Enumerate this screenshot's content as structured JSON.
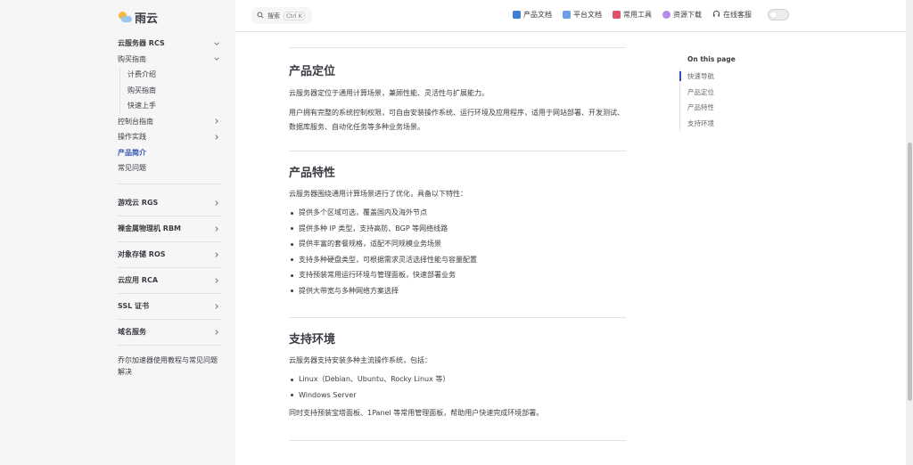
{
  "brand": {
    "name": "雨云"
  },
  "search": {
    "label": "搜索",
    "shortcut": "Ctrl K"
  },
  "topnav": [
    {
      "label": "产品文档",
      "icon": "book-icon",
      "color": "#3e7ed6"
    },
    {
      "label": "平台文档",
      "icon": "doc-icon",
      "color": "#6aa0e8"
    },
    {
      "label": "常用工具",
      "icon": "toolbox-icon",
      "color": "#e0506a"
    },
    {
      "label": "资源下载",
      "icon": "download-icon",
      "color": "#b88ce6"
    },
    {
      "label": "在线客服",
      "icon": "headset-icon",
      "color": "#555555"
    }
  ],
  "sidebar": {
    "group_title": "云服务器 RCS",
    "purchase_title": "购买指南",
    "purchase_items": [
      "计费介绍",
      "购买指南",
      "快速上手"
    ],
    "items": [
      {
        "label": "控制台指南",
        "expandable": true
      },
      {
        "label": "操作实践",
        "expandable": true
      },
      {
        "label": "产品简介",
        "active": true,
        "expandable": false
      },
      {
        "label": "常见问题",
        "expandable": false
      }
    ],
    "sections": [
      "游戏云 RGS",
      "裸金属物理机 RBM",
      "对象存储 ROS",
      "云应用 RCA",
      "SSL 证书",
      "域名服务"
    ],
    "footer": "乔尔加速器使用教程与常见问题解决"
  },
  "article": {
    "section1": {
      "title": "产品定位",
      "p1": "云服务器定位于通用计算场景，兼顾性能、灵活性与扩展能力。",
      "p2": "用户拥有完整的系统控制权限，可自由安装操作系统、运行环境及应用程序，适用于网站部署、开发测试、数据库服务、自动化任务等多种业务场景。"
    },
    "section2": {
      "title": "产品特性",
      "intro": "云服务器围绕通用计算场景进行了优化，具备以下特性：",
      "items": [
        "提供多个区域可选，覆盖国内及海外节点",
        "提供多种 IP 类型，支持高防、BGP 等网络线路",
        "提供丰富的套餐规格，适配不同规模业务场景",
        "支持多种硬盘类型，可根据需求灵活选择性能与容量配置",
        "支持预装常用运行环境与管理面板，快速部署业务",
        "提供大带宽与多种网络方案选择"
      ]
    },
    "section3": {
      "title": "支持环境",
      "intro": "云服务器支持安装多种主流操作系统，包括：",
      "items": [
        "Linux（Debian、Ubuntu、Rocky Linux 等）",
        "Windows Server"
      ],
      "outro": "同时支持预装宝塔面板、1Panel 等常用管理面板，帮助用户快速完成环境部署。"
    }
  },
  "outline": {
    "title": "On this page",
    "items": [
      "快速导航",
      "产品定位",
      "产品特性",
      "支持环境"
    ],
    "active_index": 0
  },
  "colors": {
    "accent": "#3451b2",
    "sidebar_bg": "#f6f6f7",
    "text": "#3c3c43",
    "divider": "#e2e2e3"
  }
}
